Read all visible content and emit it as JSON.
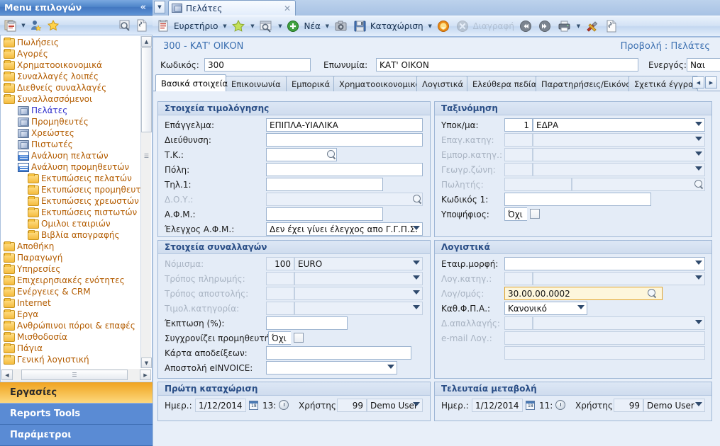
{
  "sidebar": {
    "title": "Menu επιλογών",
    "collapse_icon": "chevron-double-left-icon",
    "toolbar": [
      {
        "name": "clipboard-icon",
        "caret": true
      },
      {
        "name": "user-favorite-icon",
        "caret": false
      },
      {
        "name": "star-icon",
        "caret": false
      },
      {
        "name": "search-preview-icon",
        "caret": false
      },
      {
        "name": "document-icon",
        "caret": false
      }
    ],
    "tree": [
      {
        "label": "Πωλήσεις",
        "level": 1,
        "icon": "folder-icon",
        "selected": false
      },
      {
        "label": "Αγορές",
        "level": 1,
        "icon": "folder-icon",
        "selected": false
      },
      {
        "label": "Χρηματοοικονομικά",
        "level": 1,
        "icon": "folder-icon",
        "selected": false
      },
      {
        "label": "Συναλλαγές λοιπές",
        "level": 1,
        "icon": "folder-icon",
        "selected": false
      },
      {
        "label": "Διεθνείς συναλλαγές",
        "level": 1,
        "icon": "folder-icon",
        "selected": false
      },
      {
        "label": "Συναλλασσόμενοι",
        "level": 1,
        "icon": "folder-icon",
        "selected": false
      },
      {
        "label": "Πελάτες",
        "level": 2,
        "icon": "cube-icon",
        "selected": true
      },
      {
        "label": "Προμηθευτές",
        "level": 2,
        "icon": "cube-icon",
        "selected": false
      },
      {
        "label": "Χρεώστες",
        "level": 2,
        "icon": "cube-icon",
        "selected": false
      },
      {
        "label": "Πιστωτές",
        "level": 2,
        "icon": "cube-icon",
        "selected": false
      },
      {
        "label": "Ανάλυση πελατών",
        "level": 2,
        "icon": "grid-icon",
        "selected": false
      },
      {
        "label": "Ανάλυση προμηθευτών",
        "level": 2,
        "icon": "grid-icon",
        "selected": false
      },
      {
        "label": "Εκτυπώσεις πελατών",
        "level": 3,
        "icon": "folder-icon",
        "selected": false
      },
      {
        "label": "Εκτυπώσεις προμηθευτών",
        "level": 3,
        "icon": "folder-icon",
        "selected": false
      },
      {
        "label": "Εκτυπώσεις χρεωστών",
        "level": 3,
        "icon": "folder-icon",
        "selected": false
      },
      {
        "label": "Εκτυπώσεις πιστωτών",
        "level": 3,
        "icon": "folder-icon",
        "selected": false
      },
      {
        "label": "Ομιλοι εταιριών",
        "level": 3,
        "icon": "folder-icon",
        "selected": false
      },
      {
        "label": "Βιβλία απογραφής",
        "level": 3,
        "icon": "folder-icon",
        "selected": false
      },
      {
        "label": "Αποθήκη",
        "level": 1,
        "icon": "folder-icon",
        "selected": false
      },
      {
        "label": "Παραγωγή",
        "level": 1,
        "icon": "folder-icon",
        "selected": false
      },
      {
        "label": "Υπηρεσίες",
        "level": 1,
        "icon": "folder-icon",
        "selected": false
      },
      {
        "label": "Επιχειρησιακές ενότητες",
        "level": 1,
        "icon": "folder-icon",
        "selected": false
      },
      {
        "label": "Ενέργειες & CRM",
        "level": 1,
        "icon": "folder-icon",
        "selected": false
      },
      {
        "label": "Internet",
        "level": 1,
        "icon": "folder-icon",
        "selected": false
      },
      {
        "label": "Εργα",
        "level": 1,
        "icon": "folder-icon",
        "selected": false
      },
      {
        "label": "Ανθρώπινοι πόροι & επαφές",
        "level": 1,
        "icon": "folder-icon",
        "selected": false
      },
      {
        "label": "Μισθοδοσία",
        "level": 1,
        "icon": "folder-icon",
        "selected": false
      },
      {
        "label": "Πάγια",
        "level": 1,
        "icon": "folder-icon",
        "selected": false
      },
      {
        "label": "Γενική λογιστική",
        "level": 1,
        "icon": "folder-icon",
        "selected": false
      }
    ],
    "sections": [
      {
        "label": "Εργασίες",
        "style": "accent"
      },
      {
        "label": "Reports Tools",
        "style": "plain"
      },
      {
        "label": "Παράμετροι",
        "style": "plain"
      }
    ]
  },
  "doctab": {
    "label": "Πελάτες",
    "icon": "cube-icon",
    "close_icon": "close-icon",
    "dropdown_icon": "chevron-down-icon"
  },
  "toolbar": {
    "items": [
      {
        "label": "Ευρετήριο",
        "icon": "index-clipboard-icon",
        "caret": true,
        "disabled": false
      },
      {
        "label": "",
        "icon": "star-icon",
        "caret": true,
        "disabled": false
      },
      {
        "label": "",
        "icon": "search-window-icon",
        "caret": true,
        "disabled": false
      },
      {
        "label": "Νέα",
        "icon": "new-plus-icon",
        "caret": true,
        "disabled": false
      },
      {
        "label": "",
        "icon": "copy-camera-icon",
        "caret": false,
        "disabled": false
      },
      {
        "label": "Καταχώριση",
        "icon": "save-floppy-icon",
        "caret": true,
        "disabled": false
      },
      {
        "label": "",
        "icon": "refresh-circle-icon",
        "caret": false,
        "disabled": false
      },
      {
        "label": "Διαγραφή",
        "icon": "delete-x-icon",
        "caret": false,
        "disabled": true
      },
      {
        "label": "",
        "icon": "previous-arrow-icon",
        "caret": false,
        "disabled": false
      },
      {
        "label": "",
        "icon": "next-arrow-icon",
        "caret": false,
        "disabled": false
      },
      {
        "label": "",
        "icon": "print-icon",
        "caret": true,
        "disabled": false
      },
      {
        "label": "",
        "icon": "tools-icon",
        "caret": false,
        "disabled": false
      },
      {
        "label": "",
        "icon": "note-document-icon",
        "caret": false,
        "disabled": false
      }
    ]
  },
  "record": {
    "header_title": "300 - ΚΑΤ' ΟΙΚΟΝ",
    "header_right": "Προβολή : Πελάτες",
    "code_label": "Κωδικός:",
    "code_value": "300",
    "name_label": "Επωνυμία:",
    "name_value": "ΚΑΤ' ΟΙΚΟΝ",
    "active_label": "Ενεργός:",
    "active_value": "Ναι",
    "active_checked": true
  },
  "tabs": [
    {
      "label": "Βασικά στοιχεία",
      "active": true
    },
    {
      "label": "Επικοινωνία",
      "active": false
    },
    {
      "label": "Εμπορικά",
      "active": false
    },
    {
      "label": "Χρηματοοικονομικά",
      "active": false
    },
    {
      "label": "Λογιστικά",
      "active": false
    },
    {
      "label": "Ελεύθερα πεδία",
      "active": false
    },
    {
      "label": "Παρατηρήσεις/Εικόνα",
      "active": false
    },
    {
      "label": "Σχετικά έγγραφα",
      "active": false
    }
  ],
  "tab_nav": {
    "prev_icon": "triangle-left-icon",
    "next_icon": "triangle-right-icon"
  },
  "panels": {
    "billing": {
      "title": "Στοιχεία τιμολόγησης",
      "fields": [
        {
          "label": "Επάγγελμα:",
          "value": "ΕΠΙΠΛΑ-ΥΙΑΛΙΚΑ",
          "type": "text",
          "disabled": false
        },
        {
          "label": "Διεύθυνση:",
          "value": "",
          "type": "text",
          "disabled": false
        },
        {
          "label": "Τ.Κ.:",
          "value": "",
          "type": "lookup-short",
          "disabled": false
        },
        {
          "label": "Πόλη:",
          "value": "",
          "type": "text",
          "disabled": false
        },
        {
          "label": "Τηλ.1:",
          "value": "",
          "type": "text-mid",
          "disabled": false
        },
        {
          "label": "Δ.Ο.Υ.:",
          "value": "",
          "type": "lookup",
          "disabled": true
        },
        {
          "label": "Α.Φ.Μ.:",
          "value": "",
          "type": "text-mid",
          "disabled": false
        },
        {
          "label": "Έλεγχος Α.Φ.Μ.:",
          "value": "Δεν έχει γίνει έλεγχος απο Γ.Γ.Π.Σ.",
          "type": "select",
          "disabled": false
        }
      ]
    },
    "classification": {
      "title": "Ταξινόμηση",
      "fields": [
        {
          "label": "Υποκ/μα:",
          "code": "1",
          "value": "ΕΔΡΑ",
          "type": "code-select",
          "disabled": false
        },
        {
          "label": "Επαγ.κατηγ:",
          "code": "",
          "value": "",
          "type": "code-select",
          "disabled": true
        },
        {
          "label": "Εμπορ.κατηγ.:",
          "code": "",
          "value": "",
          "type": "code-select",
          "disabled": true
        },
        {
          "label": "Γεωγρ.ζώνη:",
          "code": "",
          "value": "",
          "type": "code-select",
          "disabled": true
        },
        {
          "label": "Πωλητής:",
          "code": "",
          "value": "",
          "type": "code-lookup",
          "disabled": true
        },
        {
          "label": "Κωδικός 1:",
          "code": "",
          "value": "",
          "type": "text-mid",
          "disabled": false
        },
        {
          "label": "Υποψήφιος:",
          "code": "",
          "value": "Όχι",
          "type": "checkbox",
          "checked": false,
          "disabled": false
        }
      ]
    },
    "transactions": {
      "title": "Στοιχεία συναλλαγών",
      "fields": [
        {
          "label": "Νόμισμα:",
          "code": "100",
          "value": "EURO",
          "type": "code-select",
          "disabled": true
        },
        {
          "label": "Τρόπος πληρωμής:",
          "code": "",
          "value": "",
          "type": "code-select",
          "disabled": true
        },
        {
          "label": "Τρόπος αποστολής:",
          "code": "",
          "value": "",
          "type": "code-select",
          "disabled": true
        },
        {
          "label": "Τιμολ.κατηγορία:",
          "code": "",
          "value": "",
          "type": "code-select",
          "disabled": true
        },
        {
          "label": "Έκπτωση (%):",
          "code": "",
          "value": "",
          "type": "text-mid",
          "disabled": false
        },
        {
          "label": "Συγχρονίζει προμηθευτή:",
          "code": "",
          "value": "Όχι",
          "type": "checkbox",
          "checked": false,
          "disabled": false
        },
        {
          "label": "Κάρτα αποδείξεων:",
          "code": "",
          "value": "",
          "type": "text-wide",
          "disabled": false
        },
        {
          "label": "Αποστολή eINVOICE:",
          "code": "",
          "value": "",
          "type": "select-mid",
          "disabled": false
        }
      ]
    },
    "accounting": {
      "title": "Λογιστικά",
      "fields": [
        {
          "label": "Εταιρ.μορφή:",
          "code": "",
          "value": "",
          "type": "select",
          "disabled": false
        },
        {
          "label": "Λογ.κατηγ.:",
          "code": "",
          "value": "",
          "type": "code-select",
          "disabled": true
        },
        {
          "label": "Λογ/σμός:",
          "code": "",
          "value": "30.00.00.0002",
          "type": "lookup-highlight",
          "disabled": true
        },
        {
          "label": "Καθ.Φ.Π.Α.:",
          "code": "",
          "value": "Κανονικό",
          "type": "select-short",
          "disabled": false
        },
        {
          "label": "Δ.απαλλαγής:",
          "code": "",
          "value": "",
          "type": "code-select",
          "disabled": true
        },
        {
          "label": "e-mail Λογ.:",
          "code": "",
          "value": "",
          "type": "text-wide",
          "disabled": true
        },
        {
          "label": "",
          "code": "",
          "value": "",
          "type": "text-wide",
          "disabled": true
        }
      ]
    },
    "first_entry": {
      "title": "Πρώτη καταχώριση",
      "date_label": "Ημερ.:",
      "date_value": "1/12/2014",
      "time_value": "13:",
      "user_label": "Χρήστης:",
      "user_code": "99",
      "user_name": "Demo User",
      "calendar_icon": "calendar-icon",
      "clock_icon": "clock-icon"
    },
    "last_change": {
      "title": "Τελευταία μεταβολή",
      "date_label": "Ημερ.:",
      "date_value": "1/12/2014",
      "time_value": "11:",
      "user_label": "Χρήστης:",
      "user_code": "99",
      "user_name": "Demo User",
      "calendar_icon": "calendar-icon",
      "clock_icon": "clock-icon"
    }
  },
  "colors": {
    "accent_blue": "#4377c0",
    "sidebar_section_orange": "#f0a321",
    "sidebar_section_blue": "#5a8bd4",
    "panel_bg": "#e4ecf7",
    "highlight_field": "#fdf6dc",
    "highlight_border": "#e0a32a",
    "tree_label": "#b35c00",
    "tree_selected_label": "#2f2fcc",
    "header_title": "#3b6fb0"
  }
}
